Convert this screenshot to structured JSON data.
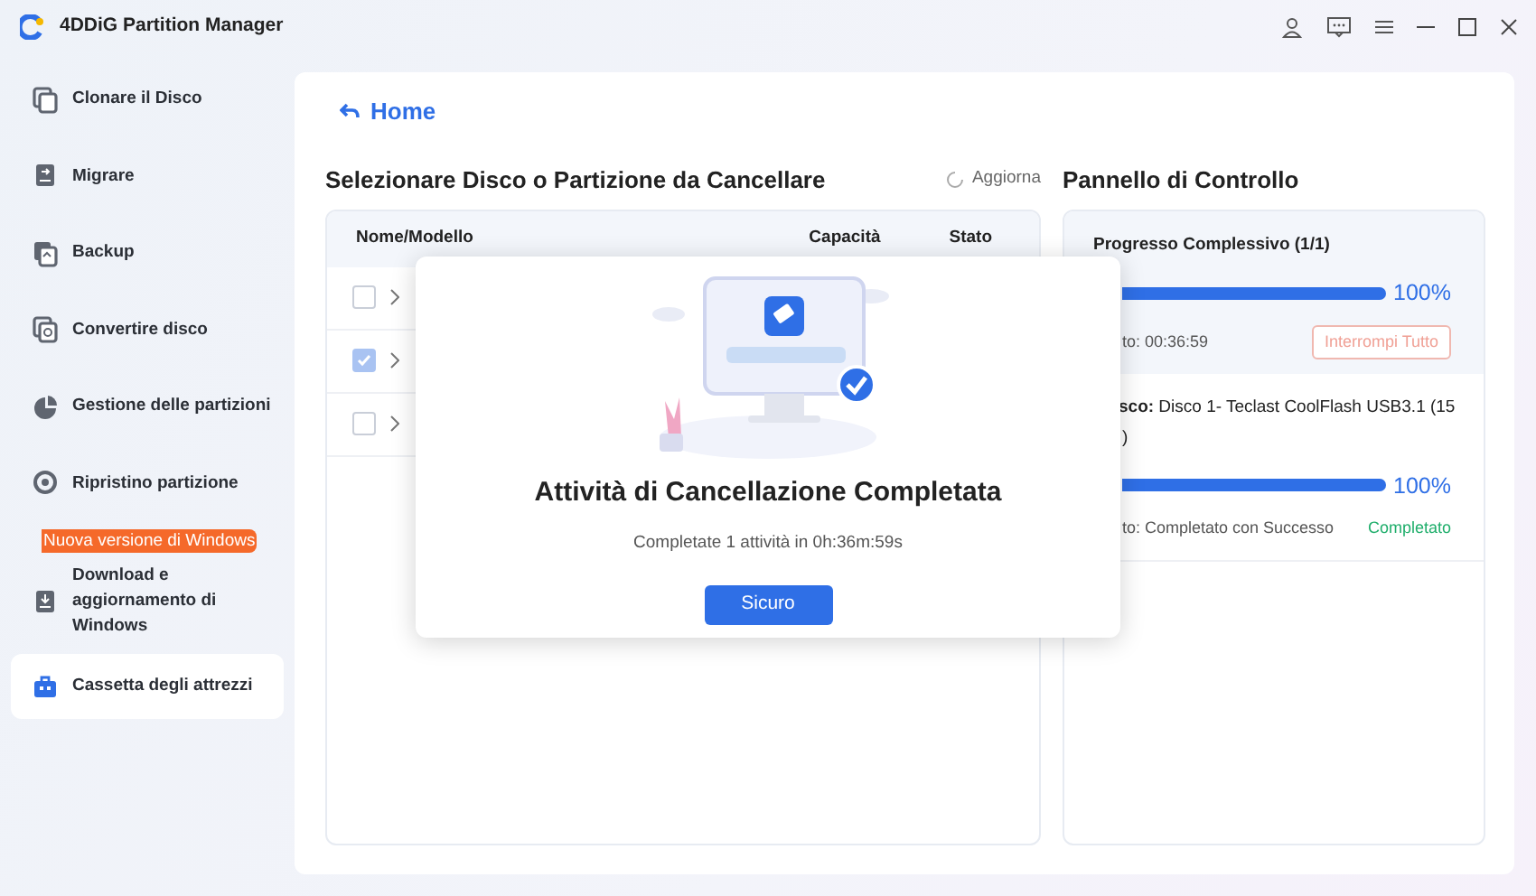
{
  "app": {
    "title": "4DDiG Partition Manager"
  },
  "sidebar": {
    "items": [
      {
        "label": "Clonare il Disco",
        "selected": false
      },
      {
        "label": "Migrare",
        "selected": false
      },
      {
        "label": "Backup",
        "selected": false
      },
      {
        "label": "Convertire disco",
        "selected": false
      },
      {
        "label": "Gestione delle partizioni",
        "selected": false
      },
      {
        "label": "Ripristino partizione",
        "selected": false
      },
      {
        "label": "Download e aggiornamento di Windows",
        "badge": "Nuova versione di Windows",
        "selected": false
      },
      {
        "label": "Cassetta degli attrezzi",
        "selected": true
      }
    ]
  },
  "home_link": "Home",
  "disk_section": {
    "title": "Selezionare Disco o Partizione da Cancellare",
    "refresh": "Aggiorna",
    "columns": [
      "Nome/Modello",
      "Capacità",
      "Stato"
    ],
    "rows": [
      {
        "checked": false
      },
      {
        "checked": true
      },
      {
        "checked": false
      }
    ]
  },
  "control_panel": {
    "title": "Pannello di Controllo",
    "overall": {
      "label": "Progresso Complessivo (1/1)",
      "level": 1,
      "percent": "100%",
      "time": "to: 00:36:59",
      "stop_button": {
        "label": "Interrompi Tutto",
        "disabled": true
      }
    },
    "tasks": [
      {
        "disk_line": "**sco:** Disco 1- Teclast CoolFlash USB3.1 (15",
        "disk_line_2": ")",
        "level": 1,
        "percent": "100%",
        "status": "to: Completato con Successo",
        "result": "Completato"
      }
    ]
  },
  "dialog": {
    "title": "Attività di Cancellazione Completata",
    "message": "Completate 1 attività in 0h:36m:59s",
    "button": "Sicuro"
  }
}
